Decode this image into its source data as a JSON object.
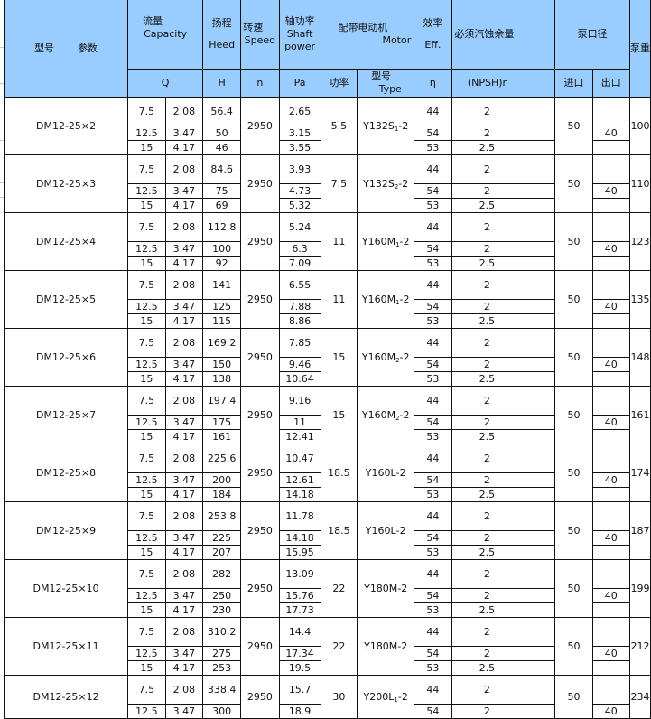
{
  "header": {
    "model_label": "型号",
    "param_label": "参数",
    "capacity_cn": "流量",
    "capacity_en": "Capacity",
    "head_cn": "扬程",
    "head_en": "Heed",
    "speed_cn": "转速",
    "speed_en": "Speed",
    "shaft_cn": "轴功率",
    "shaft_en1": "Shaft",
    "shaft_en2": "power",
    "motor_cn": "配带电动机",
    "motor_en": "Motor",
    "eff_cn": "效率",
    "eff_en": "Eff.",
    "npsh_cn": "必须汽蚀余量",
    "port_cn": "泵口径",
    "weight_cn": "泵重",
    "sub": {
      "q": "Q",
      "h": "H",
      "n": "n",
      "pa": "Pa",
      "power": "功率",
      "type_cn": "型号",
      "type_en": "Type",
      "eta": "η",
      "npsh": "(NPSH)r",
      "inlet": "进口",
      "outlet": "出口"
    }
  },
  "rows": [
    {
      "model": "DM12-25×2",
      "q1": [
        "7.5",
        "12.5",
        "15"
      ],
      "q2": [
        "2.08",
        "3.47",
        "4.17"
      ],
      "h": [
        "56.4",
        "50",
        "46"
      ],
      "n": "2950",
      "pa": [
        "2.65",
        "3.15",
        "3.55"
      ],
      "power": "5.5",
      "type_main": "Y132S",
      "type_sub": "1",
      "type_tail": "-2",
      "eff": [
        "44",
        "54",
        "53"
      ],
      "npsh": [
        "2",
        "2",
        "2.5"
      ],
      "inlet": "50",
      "outlet": "40",
      "weight": "100"
    },
    {
      "model": "DM12-25×3",
      "q1": [
        "7.5",
        "12.5",
        "15"
      ],
      "q2": [
        "2.08",
        "3.47",
        "4.17"
      ],
      "h": [
        "84.6",
        "75",
        "69"
      ],
      "n": "2950",
      "pa": [
        "3.93",
        "4.73",
        "5.32"
      ],
      "power": "7.5",
      "type_main": "Y132S",
      "type_sub": "2",
      "type_tail": "-2",
      "eff": [
        "44",
        "54",
        "53"
      ],
      "npsh": [
        "2",
        "2",
        "2.5"
      ],
      "inlet": "50",
      "outlet": "40",
      "weight": "110"
    },
    {
      "model": "DM12-25×4",
      "q1": [
        "7.5",
        "12.5",
        "15"
      ],
      "q2": [
        "2.08",
        "3.47",
        "4.17"
      ],
      "h": [
        "112.8",
        "100",
        "92"
      ],
      "n": "2950",
      "pa": [
        "5.24",
        "6.3",
        "7.09"
      ],
      "power": "11",
      "type_main": "Y160M",
      "type_sub": "1",
      "type_tail": "-2",
      "eff": [
        "44",
        "54",
        "53"
      ],
      "npsh": [
        "2",
        "2",
        "2.5"
      ],
      "inlet": "50",
      "outlet": "40",
      "weight": "123"
    },
    {
      "model": "DM12-25×5",
      "q1": [
        "7.5",
        "12.5",
        "15"
      ],
      "q2": [
        "2.08",
        "3.47",
        "4.17"
      ],
      "h": [
        "141",
        "125",
        "115"
      ],
      "n": "2950",
      "pa": [
        "6.55",
        "7.88",
        "8.86"
      ],
      "power": "11",
      "type_main": "Y160M",
      "type_sub": "1",
      "type_tail": "-2",
      "eff": [
        "44",
        "54",
        "53"
      ],
      "npsh": [
        "2",
        "2",
        "2.5"
      ],
      "inlet": "50",
      "outlet": "40",
      "weight": "135"
    },
    {
      "model": "DM12-25×6",
      "q1": [
        "7.5",
        "12.5",
        "15"
      ],
      "q2": [
        "2.08",
        "3.47",
        "4.17"
      ],
      "h": [
        "169.2",
        "150",
        "138"
      ],
      "n": "2950",
      "pa": [
        "7.85",
        "9.46",
        "10.64"
      ],
      "power": "15",
      "type_main": "Y160M",
      "type_sub": "2",
      "type_tail": "-2",
      "eff": [
        "44",
        "54",
        "53"
      ],
      "npsh": [
        "2",
        "2",
        "2.5"
      ],
      "inlet": "50",
      "outlet": "40",
      "weight": "148"
    },
    {
      "model": "DM12-25×7",
      "q1": [
        "7.5",
        "12.5",
        "15"
      ],
      "q2": [
        "2.08",
        "3.47",
        "4.17"
      ],
      "h": [
        "197.4",
        "175",
        "161"
      ],
      "n": "2950",
      "pa": [
        "9.16",
        "11",
        "12.41"
      ],
      "power": "15",
      "type_main": "Y160M",
      "type_sub": "2",
      "type_tail": "-2",
      "eff": [
        "44",
        "54",
        "53"
      ],
      "npsh": [
        "2",
        "2",
        "2.5"
      ],
      "inlet": "50",
      "outlet": "40",
      "weight": "161"
    },
    {
      "model": "DM12-25×8",
      "q1": [
        "7.5",
        "12.5",
        "15"
      ],
      "q2": [
        "2.08",
        "3.47",
        "4.17"
      ],
      "h": [
        "225.6",
        "200",
        "184"
      ],
      "n": "2950",
      "pa": [
        "10.47",
        "12.61",
        "14.18"
      ],
      "power": "18.5",
      "type_main": "Y160L",
      "type_sub": "",
      "type_tail": "-2",
      "eff": [
        "44",
        "54",
        "53"
      ],
      "npsh": [
        "2",
        "2",
        "2.5"
      ],
      "inlet": "50",
      "outlet": "40",
      "weight": "174"
    },
    {
      "model": "DM12-25×9",
      "q1": [
        "7.5",
        "12.5",
        "15"
      ],
      "q2": [
        "2.08",
        "3.47",
        "4.17"
      ],
      "h": [
        "253.8",
        "225",
        "207"
      ],
      "n": "2950",
      "pa": [
        "11.78",
        "14.18",
        "15.95"
      ],
      "power": "18.5",
      "type_main": "Y160L",
      "type_sub": "",
      "type_tail": "-2",
      "eff": [
        "44",
        "54",
        "53"
      ],
      "npsh": [
        "2",
        "2",
        "2.5"
      ],
      "inlet": "50",
      "outlet": "40",
      "weight": "187"
    },
    {
      "model": "DM12-25×10",
      "q1": [
        "7.5",
        "12.5",
        "15"
      ],
      "q2": [
        "2.08",
        "3.47",
        "4.17"
      ],
      "h": [
        "282",
        "250",
        "230"
      ],
      "n": "2950",
      "pa": [
        "13.09",
        "15.76",
        "17.73"
      ],
      "power": "22",
      "type_main": "Y180M",
      "type_sub": "",
      "type_tail": "-2",
      "eff": [
        "44",
        "54",
        "53"
      ],
      "npsh": [
        "2",
        "2",
        "2.5"
      ],
      "inlet": "50",
      "outlet": "40",
      "weight": "199"
    },
    {
      "model": "DM12-25×11",
      "q1": [
        "7.5",
        "12.5",
        "15"
      ],
      "q2": [
        "2.08",
        "3.47",
        "4.17"
      ],
      "h": [
        "310.2",
        "275",
        "253"
      ],
      "n": "2950",
      "pa": [
        "14.4",
        "17.34",
        "19.5"
      ],
      "power": "22",
      "type_main": "Y180M",
      "type_sub": "",
      "type_tail": "-2",
      "eff": [
        "44",
        "54",
        "53"
      ],
      "npsh": [
        "2",
        "2",
        "2.5"
      ],
      "inlet": "50",
      "outlet": "40",
      "weight": "212"
    },
    {
      "model": "DM12-25×12",
      "q1": [
        "7.5",
        "12.5"
      ],
      "q2": [
        "2.08",
        "3.47"
      ],
      "h": [
        "338.4",
        "300"
      ],
      "n": "2950",
      "pa": [
        "15.7",
        "18.9"
      ],
      "power": "30",
      "type_main": "Y200L",
      "type_sub": "1",
      "type_tail": "-2",
      "eff": [
        "44",
        "54"
      ],
      "npsh": [
        "2",
        "2"
      ],
      "inlet": "50",
      "outlet": "40",
      "weight": "234"
    }
  ]
}
